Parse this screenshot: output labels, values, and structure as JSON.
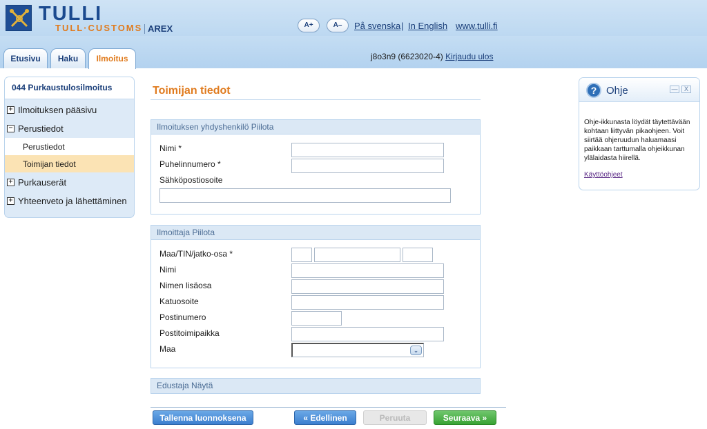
{
  "header": {
    "brand_main": "TULLI",
    "brand_sub": "TULL·CUSTOMS",
    "app_name": "AREX",
    "font_increase": "A+",
    "font_decrease": "A–",
    "link_swedish": "På svenska",
    "separator": "|",
    "link_english": "In English",
    "link_site": "www.tulli.fi"
  },
  "tabs": [
    {
      "label": "Etusivu"
    },
    {
      "label": "Haku"
    },
    {
      "label": "Ilmoitus"
    }
  ],
  "user": {
    "id_text": "j8o3n9 (6623020-4)",
    "logout": "Kirjaudu ulos"
  },
  "sidebar": {
    "title": "044 Purkaustulosilmoitus",
    "items": [
      {
        "label": "Ilmoituksen pääsivu",
        "toggle": "+"
      },
      {
        "label": "Perustiedot",
        "toggle": "−"
      },
      {
        "label": "Perustiedot"
      },
      {
        "label": "Toimijan tiedot"
      },
      {
        "label": "Purkauserät",
        "toggle": "+"
      },
      {
        "label": "Yhteenveto ja lähettäminen",
        "toggle": "+"
      }
    ]
  },
  "main": {
    "title": "Toimijan tiedot",
    "contact_panel": {
      "heading": "Ilmoituksen yhdyshenkilö Piilota",
      "name_label": "Nimi *",
      "phone_label": "Puhelinnumero *",
      "email_label": "Sähköpostiosoite"
    },
    "declarant_panel": {
      "heading": "Ilmoittaja Piilota",
      "tin_label": "Maa/TIN/jatko-osa *",
      "name_label": "Nimi",
      "name_ext_label": "Nimen lisäosa",
      "street_label": "Katuosoite",
      "postcode_label": "Postinumero",
      "city_label": "Postitoimipaikka",
      "country_label": "Maa",
      "country_selected": ""
    },
    "representative_panel": {
      "heading": "Edustaja Näytä"
    }
  },
  "buttons": {
    "save_draft": "Tallenna luonnoksena",
    "previous": "Edellinen",
    "cancel": "Peruuta",
    "next": "Seuraava"
  },
  "help": {
    "title": "Ohje",
    "minimize": "—",
    "close": "X",
    "text": "Ohje-ikkunasta löydät täytettävään kohtaan liittyvän pikaohjeen. Voit siirtää ohjeruudun haluamaasi paikkaan tarttumalla ohjeikkunan ylälaidasta hiirellä.",
    "link": "Käyttöohjeet"
  }
}
